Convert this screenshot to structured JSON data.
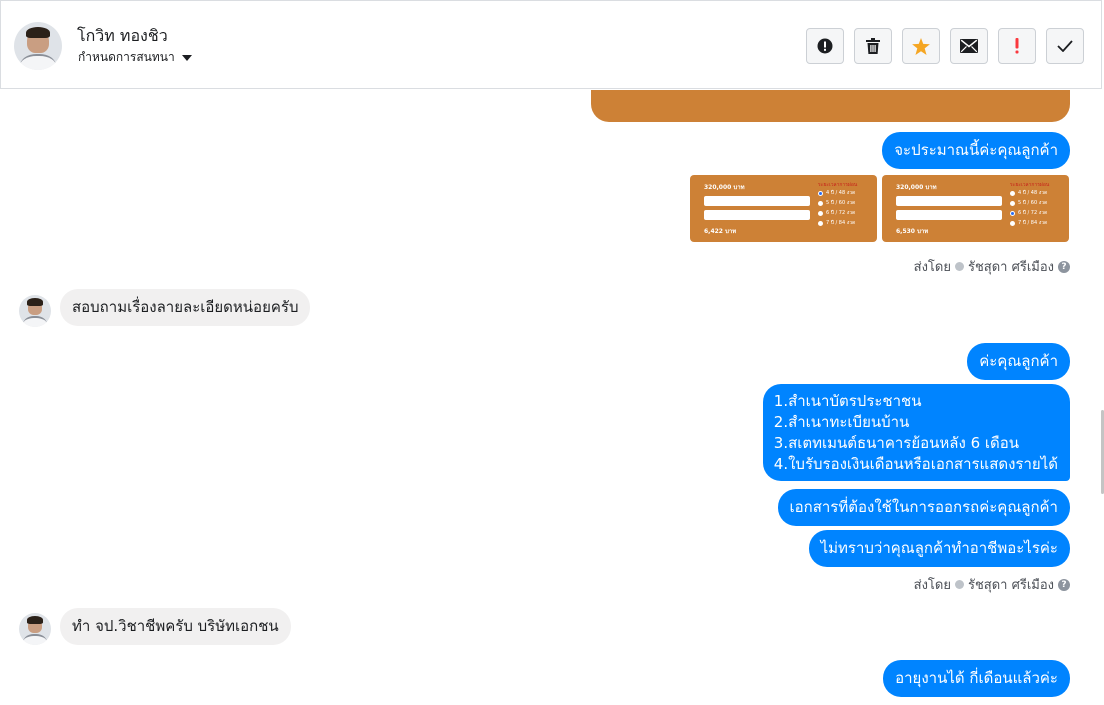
{
  "header": {
    "contact_name": "โกวิท ทองชิว",
    "assign_label": "กำหนดการสนทนา",
    "toolbar": [
      {
        "icon": "alert-circle-icon"
      },
      {
        "icon": "trash-icon"
      },
      {
        "icon": "star-icon",
        "color": "#f5a623"
      },
      {
        "icon": "envelope-icon"
      },
      {
        "icon": "exclamation-icon",
        "color": "#fa383e"
      },
      {
        "icon": "checkmark-icon"
      }
    ]
  },
  "messages": {
    "m1": "จะประมาณนี้ค่ะคุณลูกค้า",
    "sent_by_1": "ส่งโดย",
    "agent_1": "รัชสุดา ศรีเมือง",
    "m2": "สอบถามเรื่องลายละเอียดหน่อยครับ",
    "m3": "ค่ะคุณลูกค้า",
    "m4_lines": [
      "1.สำเนาบัตรประชาชน",
      "2.สำเนาทะเบียนบ้าน",
      "3.สเตทเมนต์ธนาคารย้อนหลัง 6 เดือน",
      "4.ใบรับรองเงินเดือนหรือเอกสารแสดงรายได้"
    ],
    "m5": "เอกสารที่ต้องใช้ในการออกรถค่ะคุณลูกค้า",
    "m6": "ไม่ทราบว่าคุณลูกค้าทำอาชีพอะไรค่ะ",
    "sent_by_2": "ส่งโดย",
    "agent_2": "รัชสุดา ศรีเมือง",
    "m7": "ทำ จป.วิชาชีพครับ บริษัทเอกชน",
    "m8": "อายุงานได้ กี่เดือนแล้วค่ะ"
  },
  "thumbnails": [
    {
      "amount": "320,000 บาท",
      "result": "6,422 บาท",
      "title": "ระยะเวลาการผ่อน",
      "options": [
        "4 ปี / 48 งวด",
        "5 ปี / 60 งวด",
        "6 ปี / 72 งวด",
        "7 ปี / 84 งวด"
      ],
      "selected": 0
    },
    {
      "amount": "320,000 บาท",
      "result": "6,530 บาท",
      "title": "ระยะเวลาการผ่อน",
      "options": [
        "4 ปี / 48 งวด",
        "5 ปี / 60 งวด",
        "6 ปี / 72 งวด",
        "7 ปี / 84 งวด"
      ],
      "selected": 2
    }
  ],
  "colors": {
    "outgoing": "#0084ff",
    "incoming": "#f1f0f0",
    "media": "#cd8136"
  }
}
